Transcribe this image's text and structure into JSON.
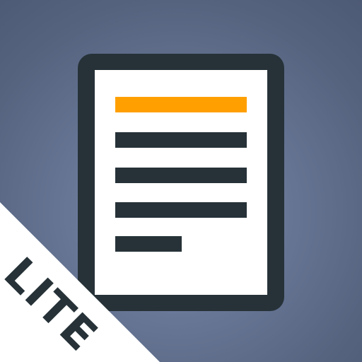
{
  "badge": {
    "label": "LITE"
  },
  "icon": {
    "name": "document-icon"
  },
  "colors": {
    "background": "#5a6a88",
    "document_frame": "#263238",
    "document_paper": "#ffffff",
    "highlight_line": "#ffa000",
    "text_line": "#263238",
    "badge_background": "#ffffff",
    "badge_text": "#263238"
  }
}
